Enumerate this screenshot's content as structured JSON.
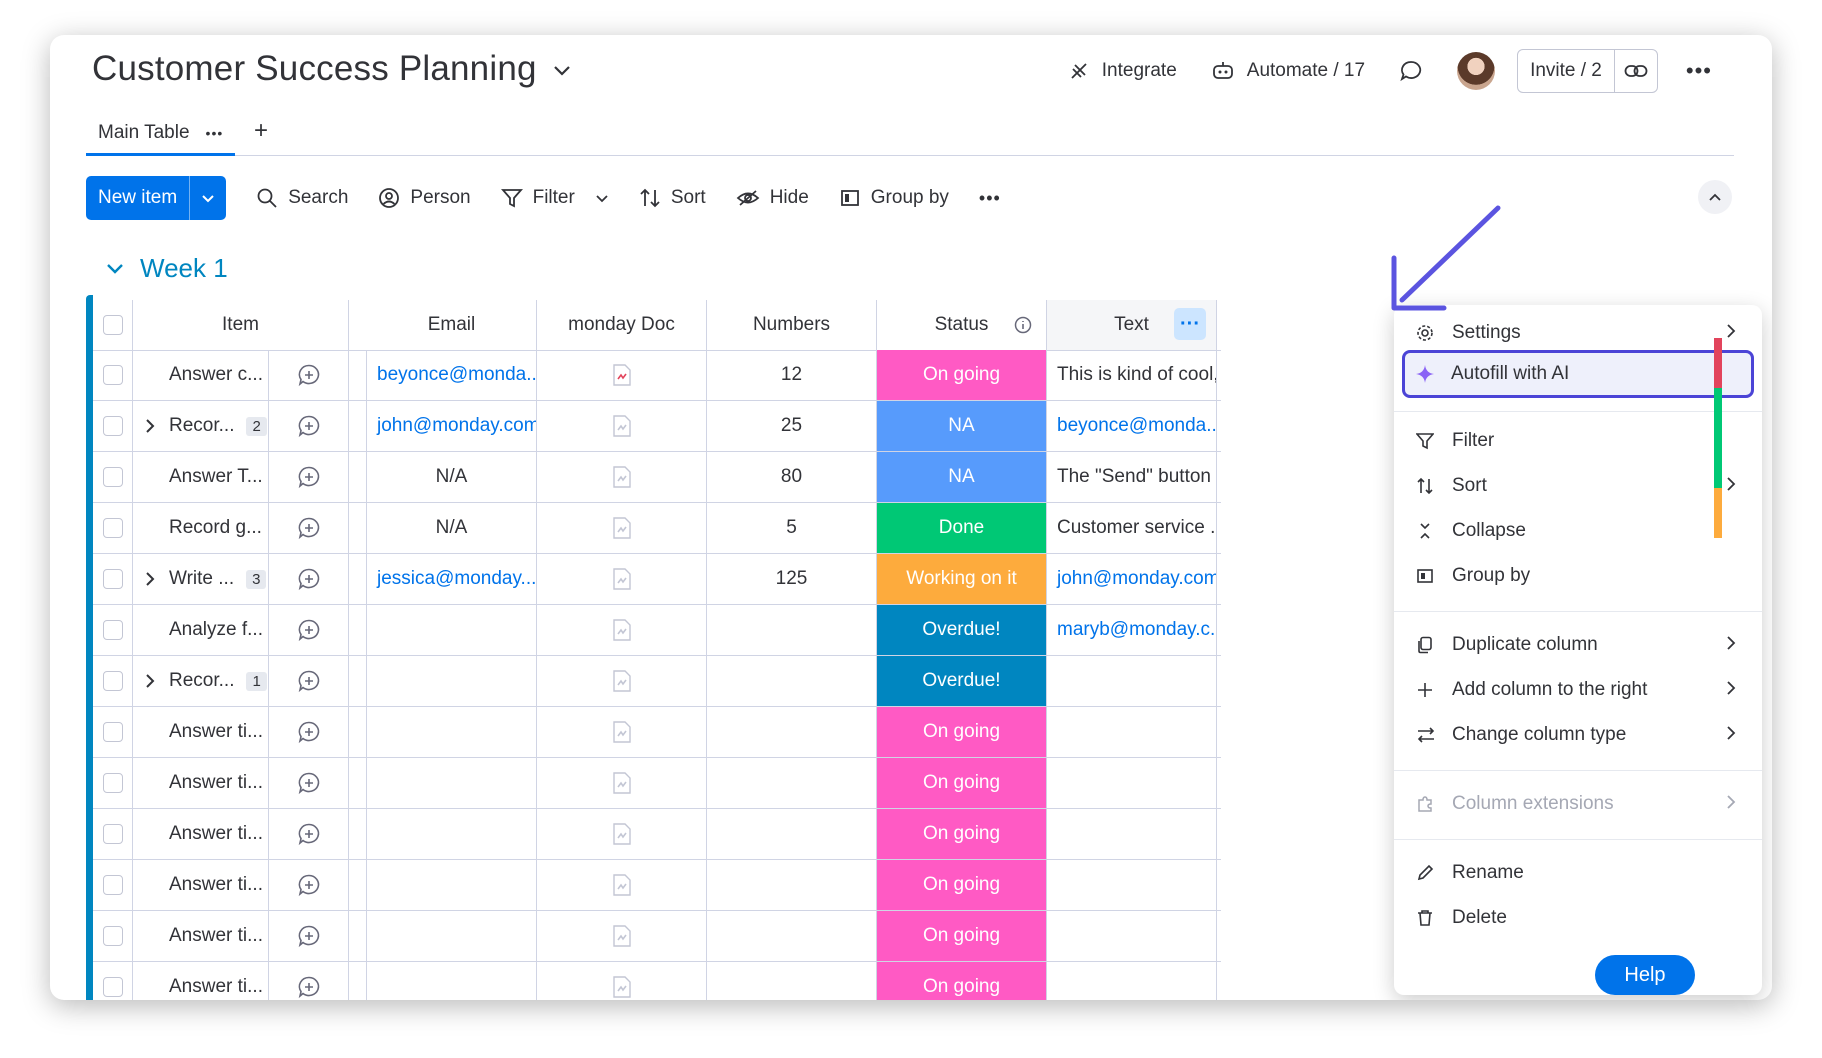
{
  "header": {
    "title": "Customer Success Planning",
    "integrate": "Integrate",
    "automate": "Automate / 17",
    "invite": "Invite / 2"
  },
  "tabs": {
    "main": "Main Table"
  },
  "toolbar": {
    "new_item": "New item",
    "search": "Search",
    "person": "Person",
    "filter": "Filter",
    "sort": "Sort",
    "hide": "Hide",
    "group_by": "Group by"
  },
  "group": {
    "title": "Week 1"
  },
  "columns": {
    "item": "Item",
    "email": "Email",
    "doc": "monday Doc",
    "numbers": "Numbers",
    "status": "Status",
    "text": "Text"
  },
  "rows": [
    {
      "item": "Answer c...",
      "count": "",
      "email": "beyonce@monda...",
      "email_link": true,
      "doc_active": true,
      "number": "12",
      "status": "On going",
      "status_color": "#ff5ac4",
      "text": "This is kind of cool, ...",
      "text_link": false
    },
    {
      "item": "Recor...",
      "count": "2",
      "email": "john@monday.com",
      "email_link": true,
      "doc_active": false,
      "number": "25",
      "status": "NA",
      "status_color": "#579bfc",
      "text": "beyonce@monda...",
      "text_link": true
    },
    {
      "item": "Answer T...",
      "count": "",
      "email": "N/A",
      "email_link": false,
      "doc_active": false,
      "number": "80",
      "status": "NA",
      "status_color": "#579bfc",
      "text": "The \"Send\" button ...",
      "text_link": false
    },
    {
      "item": "Record g...",
      "count": "",
      "email": "N/A",
      "email_link": false,
      "doc_active": false,
      "number": "5",
      "status": "Done",
      "status_color": "#00c875",
      "text": "Customer service ...",
      "text_link": false
    },
    {
      "item": "Write ...",
      "count": "3",
      "email": "jessica@monday....",
      "email_link": true,
      "doc_active": false,
      "number": "125",
      "status": "Working on it",
      "status_color": "#fdab3d",
      "text": "john@monday.com",
      "text_link": true
    },
    {
      "item": "Analyze f...",
      "count": "",
      "email": "",
      "email_link": false,
      "doc_active": false,
      "number": "",
      "status": "Overdue!",
      "status_color": "#0086c0",
      "text": "maryb@monday.c...",
      "text_link": true
    },
    {
      "item": "Recor...",
      "count": "1",
      "email": "",
      "email_link": false,
      "doc_active": false,
      "number": "",
      "status": "Overdue!",
      "status_color": "#0086c0",
      "text": "",
      "text_link": false
    },
    {
      "item": "Answer ti...",
      "count": "",
      "email": "",
      "email_link": false,
      "doc_active": false,
      "number": "",
      "status": "On going",
      "status_color": "#ff5ac4",
      "text": "",
      "text_link": false
    },
    {
      "item": "Answer ti...",
      "count": "",
      "email": "",
      "email_link": false,
      "doc_active": false,
      "number": "",
      "status": "On going",
      "status_color": "#ff5ac4",
      "text": "",
      "text_link": false
    },
    {
      "item": "Answer ti...",
      "count": "",
      "email": "",
      "email_link": false,
      "doc_active": false,
      "number": "",
      "status": "On going",
      "status_color": "#ff5ac4",
      "text": "",
      "text_link": false
    },
    {
      "item": "Answer ti...",
      "count": "",
      "email": "",
      "email_link": false,
      "doc_active": false,
      "number": "",
      "status": "On going",
      "status_color": "#ff5ac4",
      "text": "",
      "text_link": false
    },
    {
      "item": "Answer ti...",
      "count": "",
      "email": "",
      "email_link": false,
      "doc_active": false,
      "number": "",
      "status": "On going",
      "status_color": "#ff5ac4",
      "text": "",
      "text_link": false
    },
    {
      "item": "Answer ti...",
      "count": "",
      "email": "",
      "email_link": false,
      "doc_active": false,
      "number": "",
      "status": "On going",
      "status_color": "#ff5ac4",
      "text": "",
      "text_link": false
    }
  ],
  "menu": {
    "settings": "Settings",
    "autofill": "Autofill with AI",
    "filter": "Filter",
    "sort": "Sort",
    "collapse": "Collapse",
    "group_by": "Group by",
    "duplicate": "Duplicate column",
    "add_right": "Add column to the right",
    "change_type": "Change column type",
    "extensions": "Column extensions",
    "rename": "Rename",
    "delete": "Delete"
  },
  "help": "Help",
  "colors": {
    "primary": "#0073ea",
    "group": "#0086c0",
    "highlight_border": "#4b44d6"
  }
}
